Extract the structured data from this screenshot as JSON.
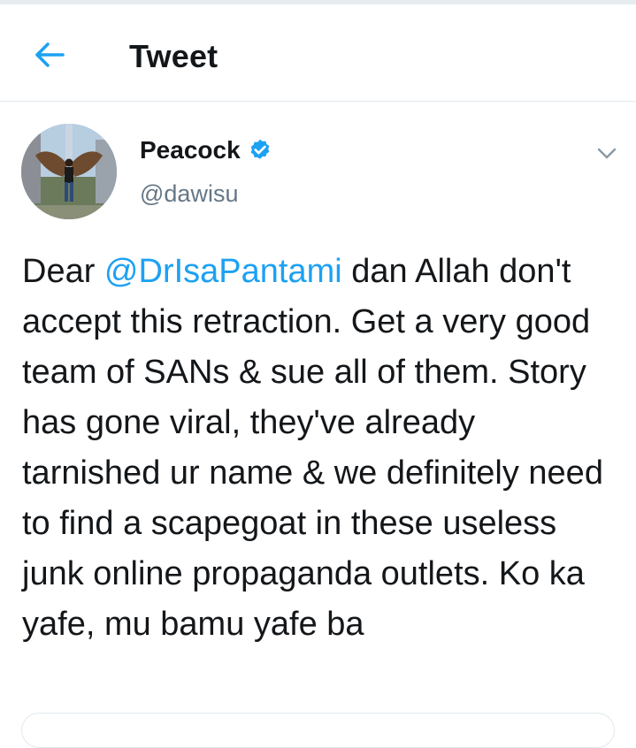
{
  "header": {
    "title": "Tweet",
    "back_icon": "arrow-left-icon",
    "accent_color": "#1da1f2"
  },
  "tweet": {
    "author": {
      "display_name": "Peacock",
      "handle": "@dawisu",
      "verified": true
    },
    "text_parts": [
      {
        "type": "text",
        "value": "Dear "
      },
      {
        "type": "mention",
        "value": "@DrIsaPantami"
      },
      {
        "type": "text",
        "value": " dan Allah don't accept this retraction. Get a very good team of SANs & sue all of them. Story has gone viral, they've already tarnished ur name & we definitely need to find a scapegoat in these useless junk online propaganda outlets. Ko ka yafe, mu bamu yafe ba"
      }
    ],
    "menu_icon": "chevron-down-icon"
  },
  "colors": {
    "text": "#14171a",
    "secondary": "#657786",
    "link": "#1da1f2",
    "border": "#e1e8ed"
  }
}
